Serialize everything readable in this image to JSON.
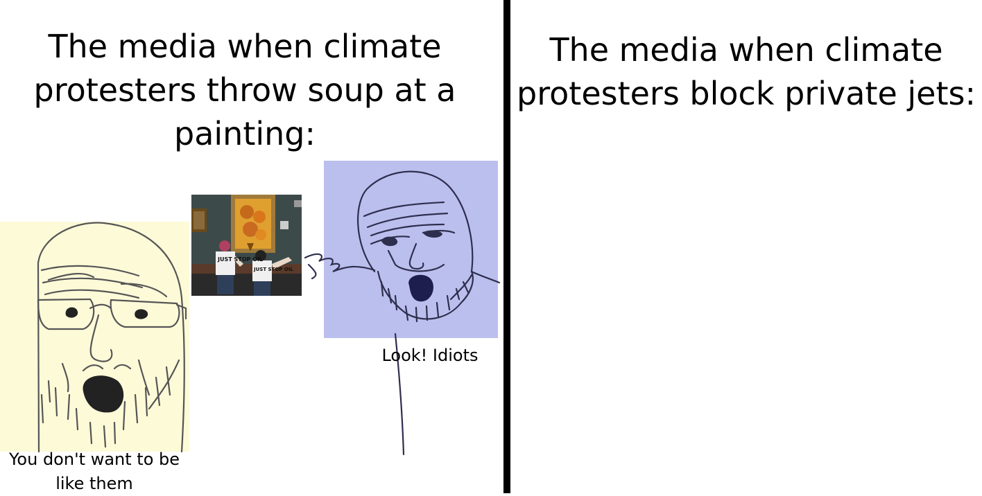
{
  "left_panel": {
    "caption": "The media when climate protesters throw soup at a painting:",
    "soyjak_left_label": "You don't want to be like them",
    "soyjak_right_label": "Look! Idiots",
    "photo_shirt_text": "JUST STOP OIL"
  },
  "right_panel": {
    "caption": "The media when climate protesters block private jets:"
  },
  "colors": {
    "left_soyjak_bg": "#fdfad8",
    "right_soyjak_bg": "#bbbfee",
    "divider": "#000000"
  }
}
